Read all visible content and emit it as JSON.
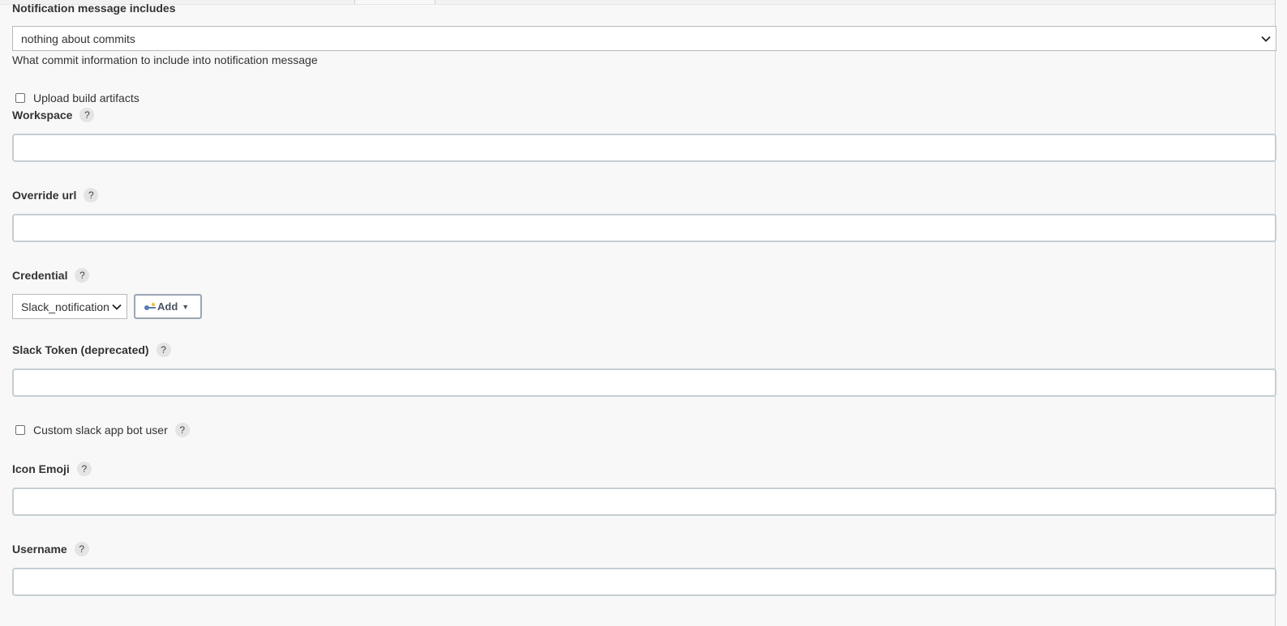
{
  "notification": {
    "label": "Notification message includes",
    "selected": "nothing about commits",
    "description": "What commit information to include into notification message"
  },
  "upload_artifacts": {
    "label": "Upload build artifacts",
    "checked": false
  },
  "workspace": {
    "label": "Workspace",
    "help": "?",
    "value": ""
  },
  "override_url": {
    "label": "Override url",
    "help": "?",
    "value": ""
  },
  "credential": {
    "label": "Credential",
    "help": "?",
    "selected": "Slack_notification",
    "add_label": "Add"
  },
  "slack_token": {
    "label": "Slack Token (deprecated)",
    "help": "?",
    "value": ""
  },
  "custom_bot_user": {
    "label": "Custom slack app bot user",
    "help": "?",
    "checked": false
  },
  "icon_emoji": {
    "label": "Icon Emoji",
    "help": "?",
    "value": ""
  },
  "username": {
    "label": "Username",
    "help": "?",
    "value": ""
  },
  "icons": {
    "select_caret": "chevron-down-icon",
    "add_caret": "caret-down-icon",
    "credentials_key": "key-icon",
    "help": "help-icon"
  },
  "colors": {
    "page_background": "#f8f8f8",
    "input_border": "#c6ced3",
    "add_button_border": "#9aa6b2",
    "key_blue": "#5b7bb5",
    "key_yellow": "#f2c230"
  }
}
